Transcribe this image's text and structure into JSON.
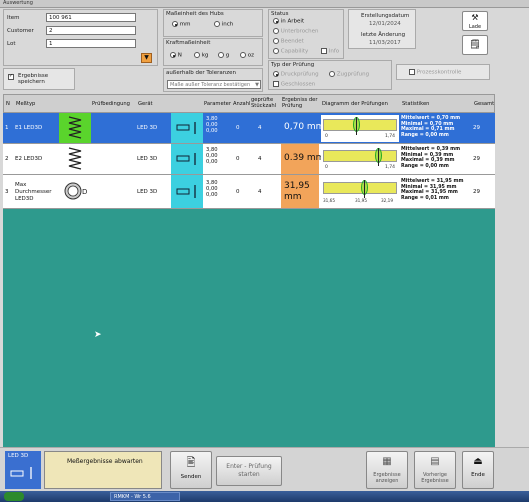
{
  "window": {
    "title": "Auswertung"
  },
  "header": {
    "item_label": "Item",
    "item_value": "100 961",
    "customer_label": "Customer",
    "customer_value": "2",
    "lot_label": "Lot",
    "lot_value": "1"
  },
  "units_hub": {
    "title": "Maßeinheit des Hubs",
    "opt_mm": "mm",
    "opt_inch": "inch"
  },
  "units_force": {
    "title": "Kraftmaßeinheit",
    "opt_n": "N",
    "opt_kg": "kg",
    "opt_g": "g",
    "opt_oz": "oz"
  },
  "status": {
    "title": "Status",
    "opt_active": "in Arbeit",
    "opt_interrupted": "Unterbrochen",
    "opt_finished": "Beendet",
    "opt_capability": "Capability",
    "opt_cpk": "Info"
  },
  "dates": {
    "created_label": "Erstellungsdatum",
    "created_value": "12/01/2024",
    "changed_label": "letzte Änderung",
    "changed_value": "11/03/2017"
  },
  "side_buttons": {
    "load": "Lade",
    "notes": ""
  },
  "results_save": {
    "label": "Ergebnisse speichern"
  },
  "tolerance": {
    "title": "außerhalb der Toleranzen",
    "select_value": "Maße außer Toleranz bestätigen"
  },
  "test_type": {
    "title": "Typ der Prüfung",
    "opt_pressure": "Druckprüfung",
    "opt_tension": "Zugprüfung",
    "opt_closed": "Geschlossen"
  },
  "process_control": {
    "label": "Prozesskontrolle"
  },
  "table": {
    "headers": {
      "n": "N",
      "test": "Meßtyp",
      "cond": "Prüfbedingung",
      "device": "Gerät",
      "params": "Parameter",
      "count": "Anzahl",
      "tested": "geprüfte Stückzahl",
      "result": "Ergebniss der Prüfung",
      "diagram": "Diagramm der Prüfungen",
      "stats": "Statistiken",
      "total": "Gesamt"
    },
    "rows": [
      {
        "n": "1",
        "name": "E1 LED3D",
        "device": "LED 3D",
        "params": [
          "3,80",
          "0,00",
          "0,00"
        ],
        "count": "0",
        "tested": "4",
        "result": "0,70 mm",
        "axis_min": "0",
        "axis_max": "1,74",
        "stat_mean": "Mittelwert = 0,70 mm",
        "stat_min": "Minimal = 0,70 mm",
        "stat_max": "Maximal = 0,71 mm",
        "stat_range": "Range = 0,00 mm",
        "total": "29"
      },
      {
        "n": "2",
        "name": "E2 LED3D",
        "device": "LED 3D",
        "params": [
          "3,80",
          "0,00",
          "0,00"
        ],
        "count": "0",
        "tested": "4",
        "result": "0.39 mm",
        "axis_min": "0",
        "axis_max": "1,74",
        "stat_mean": "Mittelwert = 0,39 mm",
        "stat_min": "Minimal = 0,39 mm",
        "stat_max": "Maximal = 0,39 mm",
        "stat_range": "Range = 0,00 mm",
        "total": "29"
      },
      {
        "n": "3",
        "name": "Max Durchmesser LED3D",
        "device": "LED 3D",
        "params": [
          "3,80",
          "0,00",
          "0,00"
        ],
        "count": "0",
        "tested": "4",
        "result": "31,95 mm",
        "axis_min": "31,65",
        "axis_mid": "31,95",
        "axis_max": "32,19",
        "stat_mean": "Mittelwert = 31,95 mm",
        "stat_min": "Minimal = 31,95 mm",
        "stat_max": "Maximal = 31,95 mm",
        "stat_range": "Range = 0,01 mm",
        "total": "29"
      }
    ]
  },
  "bottom": {
    "device_tag": "LED 3D",
    "wait_text": "Meßergebnisse abwarten",
    "send": "Senden",
    "enter_test": "Enter - Prüfung starten",
    "show_results": "Ergebnisse anzeigen",
    "prev_results": "Vorherige Ergebnisse",
    "end": "Ende"
  },
  "taskbar": {
    "item": "RMKM - Wr 5.6"
  },
  "colors": {
    "selected_row": "#2f6fd6",
    "teal": "#2e9a8d",
    "result_orange": "#f2a45a",
    "spring_green": "#5ad42c",
    "cyan_icon": "#3cd0e0",
    "diagram_yellow": "#e9e85a"
  }
}
